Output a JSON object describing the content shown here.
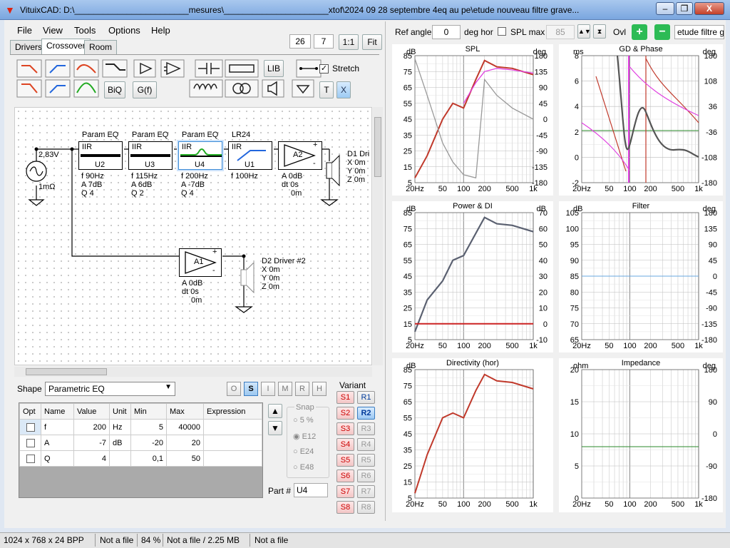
{
  "window": {
    "title": "VituixCAD: D:\\________________________mesures\\______________________xtof\\2024 09 28 septembre 4eq au pe\\etude nouveau filtre grave...",
    "min": "–",
    "max": "❐",
    "close": "X"
  },
  "menu": [
    "File",
    "View",
    "Tools",
    "Options",
    "Help"
  ],
  "toolbar": {
    "width_val": "26",
    "height_val": "7",
    "one_to_one": "1:1",
    "fit": "Fit"
  },
  "tabs": [
    "Drivers",
    "Crossover",
    "Room"
  ],
  "tools": {
    "lib": "LIB",
    "biq": "BiQ",
    "gf": "G(f)",
    "t": "T",
    "x": "X",
    "stretch": "Stretch"
  },
  "schematic": {
    "source_v": "2,83V",
    "source_r": "1mΩ",
    "blocks": [
      {
        "title": "Param EQ",
        "type": "IIR",
        "id": "U2",
        "p1": "f  90Hz",
        "p2": "A  7dB",
        "p3": "Q  4"
      },
      {
        "title": "Param EQ",
        "type": "IIR",
        "id": "U3",
        "p1": "f  115Hz",
        "p2": "A  6dB",
        "p3": "Q  2"
      },
      {
        "title": "Param EQ",
        "type": "IIR",
        "id": "U4",
        "p1": "f  200Hz",
        "p2": "A  -7dB",
        "p3": "Q  4"
      },
      {
        "title": "LR24",
        "type": "IIR",
        "id": "U1",
        "p1": "f  100Hz",
        "p2": "",
        "p3": ""
      }
    ],
    "amp2": {
      "id": "A2",
      "a": "A  0dB",
      "dt": "dt 0s",
      "z": "0m"
    },
    "amp1": {
      "id": "A1",
      "a": "A  0dB",
      "dt": "dt 0s",
      "z": "0m"
    },
    "driver1": {
      "name": "D1 Dri",
      "x": "X 0m",
      "y": "Y 0m",
      "z": "Z 0m"
    },
    "driver2": {
      "name": "D2 Driver #2",
      "x": "X 0m",
      "y": "Y 0m",
      "z": "Z 0m"
    },
    "plus": "+",
    "minus": "-"
  },
  "shape": {
    "label": "Shape",
    "value": "Parametric EQ",
    "buttons": [
      "O",
      "S",
      "I",
      "M",
      "R",
      "H"
    ]
  },
  "params": {
    "headers": [
      "Opt",
      "Name",
      "Value",
      "Unit",
      "Min",
      "Max",
      "Expression"
    ],
    "rows": [
      {
        "name": "f",
        "value": "200",
        "unit": "Hz",
        "min": "5",
        "max": "40000",
        "expr": ""
      },
      {
        "name": "A",
        "value": "-7",
        "unit": "dB",
        "min": "-20",
        "max": "20",
        "expr": ""
      },
      {
        "name": "Q",
        "value": "4",
        "unit": "",
        "min": "0,1",
        "max": "50",
        "expr": ""
      }
    ]
  },
  "snap": {
    "label": "Snap",
    "options": [
      "5 %",
      "E12",
      "E24",
      "E48"
    ]
  },
  "part": {
    "label": "Part #",
    "value": "U4"
  },
  "variant": {
    "label": "Variant",
    "s": [
      "S1",
      "S2",
      "S3",
      "S4",
      "S5",
      "S6",
      "S7",
      "S8"
    ],
    "r": [
      "R1",
      "R2",
      "R3",
      "R4",
      "R5",
      "R6",
      "R7",
      "R8"
    ]
  },
  "right_toolbar": {
    "ref_angle_label": "Ref angle",
    "ref_angle": "0",
    "deg_hor": "deg hor",
    "spl_max_label": "SPL max",
    "spl_max": "85",
    "ovl": "Ovl",
    "project": "etude filtre gra"
  },
  "charts": {
    "xticks": [
      "20Hz",
      "50",
      "100",
      "200",
      "500",
      "1k"
    ],
    "spl": {
      "title": "SPL",
      "unit_l": "dB",
      "unit_r": "deg",
      "yl": [
        "85",
        "75",
        "65",
        "55",
        "45",
        "35",
        "25",
        "15",
        "5"
      ],
      "yr": [
        "180",
        "135",
        "90",
        "45",
        "0",
        "-45",
        "-90",
        "-135",
        "-180"
      ]
    },
    "gd": {
      "title": "GD & Phase",
      "unit_l": "ms",
      "unit_r": "deg",
      "yl": [
        "8",
        "6",
        "4",
        "2",
        "0",
        "-2"
      ],
      "yr": [
        "180",
        "108",
        "36",
        "-36",
        "-108",
        "-180"
      ]
    },
    "power": {
      "title": "Power & DI",
      "unit_l": "dB",
      "unit_r": "dB",
      "yl": [
        "85",
        "75",
        "65",
        "55",
        "45",
        "35",
        "25",
        "15",
        "5"
      ],
      "yr": [
        "70",
        "60",
        "50",
        "40",
        "30",
        "20",
        "10",
        "0",
        "-10"
      ]
    },
    "filter": {
      "title": "Filter",
      "unit_l": "dB",
      "unit_r": "deg",
      "yl": [
        "105",
        "100",
        "95",
        "90",
        "85",
        "80",
        "75",
        "70",
        "65"
      ],
      "yr": [
        "180",
        "135",
        "90",
        "45",
        "0",
        "-45",
        "-90",
        "-135",
        "-180"
      ]
    },
    "dir": {
      "title": "Directivity (hor)",
      "unit_l": "dB",
      "yl": [
        "85",
        "75",
        "65",
        "55",
        "45",
        "35",
        "25",
        "15",
        "5"
      ]
    },
    "imp": {
      "title": "Impedance",
      "unit_l": "ohm",
      "unit_r": "deg",
      "yl": [
        "20",
        "15",
        "10",
        "5",
        "0"
      ],
      "yr": [
        "180",
        "90",
        "0",
        "-90",
        "-180"
      ]
    }
  },
  "chart_data": [
    {
      "type": "line",
      "title": "SPL",
      "xlabel": "",
      "ylabel": "dB",
      "x": [
        20,
        30,
        50,
        70,
        100,
        150,
        200,
        300,
        500,
        1000
      ],
      "series": [
        {
          "values": [
            8,
            22,
            45,
            55,
            52,
            70,
            82,
            78,
            77,
            73
          ],
          "color": "#c0392b"
        },
        {
          "values": [
            null,
            null,
            null,
            null,
            55,
            68,
            75,
            77,
            76,
            74
          ],
          "color": "#e040e0"
        },
        {
          "values": [
            83,
            60,
            30,
            18,
            10,
            8,
            70,
            60,
            52,
            45
          ],
          "color": "#999999"
        }
      ],
      "ylim": [
        5,
        85
      ]
    },
    {
      "type": "line",
      "title": "Power & DI",
      "ylabel": "dB",
      "x": [
        20,
        30,
        50,
        70,
        100,
        150,
        200,
        300,
        500,
        1000
      ],
      "series": [
        {
          "values": [
            10,
            30,
            42,
            55,
            58,
            72,
            82,
            78,
            77,
            73
          ],
          "color": "#5a6070"
        },
        {
          "values": [
            15,
            15,
            15,
            15,
            15,
            15,
            15,
            15,
            15,
            15
          ],
          "color": "#cc2222"
        }
      ],
      "ylim": [
        5,
        85
      ]
    },
    {
      "type": "line",
      "title": "Directivity (hor)",
      "ylabel": "dB",
      "x": [
        20,
        30,
        50,
        70,
        100,
        150,
        200,
        300,
        500,
        1000
      ],
      "series": [
        {
          "values": [
            8,
            32,
            55,
            58,
            55,
            72,
            82,
            78,
            77,
            73
          ],
          "color": "#c0392b"
        }
      ],
      "ylim": [
        5,
        85
      ]
    }
  ],
  "status": [
    "1024 x 768 x 24 BPP",
    "Not a file",
    "84 %",
    "Not a file / 2.25 MB",
    "Not a file"
  ]
}
